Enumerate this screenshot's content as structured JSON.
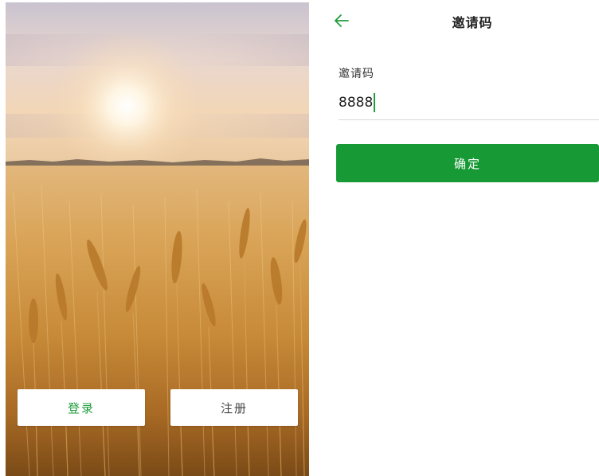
{
  "welcome_screen": {
    "login_label": "登录",
    "register_label": "注册",
    "background_image": "wheat-field-sunset",
    "login_color": "#1f9d3a"
  },
  "invite_screen": {
    "title": "邀请码",
    "back_icon": "arrow-left-icon",
    "field_label": "邀请码",
    "field_value": "8888",
    "confirm_label": "确定",
    "accent_color": "#179a35"
  }
}
